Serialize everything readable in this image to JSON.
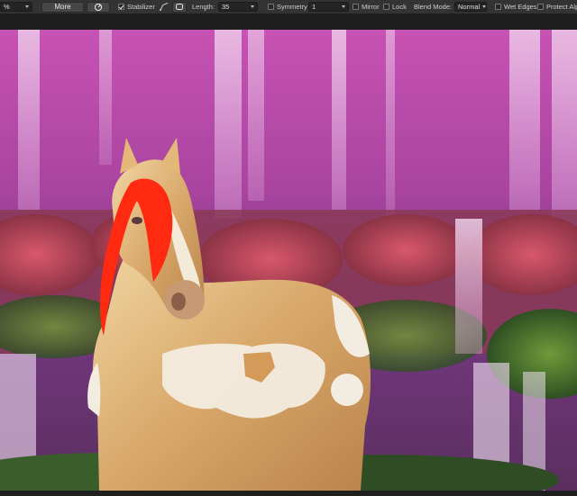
{
  "toolbar": {
    "leading_value": "%",
    "more_label": "More",
    "stabilizer_label": "Stabilizer",
    "stabilizer_checked": true,
    "length_label": "Length:",
    "length_value": "35",
    "symmetry_label": "Symmetry",
    "symmetry_value": "1",
    "mirror_label": "Mirror",
    "lock_label": "Lock",
    "blend_mode_label": "Blend Mode:",
    "blend_mode_value": "Normal",
    "wet_edges_label": "Wet Edges",
    "protect_label": "Protect Alph"
  },
  "colors": {
    "sky_top": "#c84fb4",
    "sky_mid": "#9a3f9a",
    "foliage": "#b8434e",
    "foliage_green": "#3d6b2a",
    "horse_coat": "#d9a86a",
    "horse_white": "#f3ece0",
    "mane": "#ff2a10"
  }
}
